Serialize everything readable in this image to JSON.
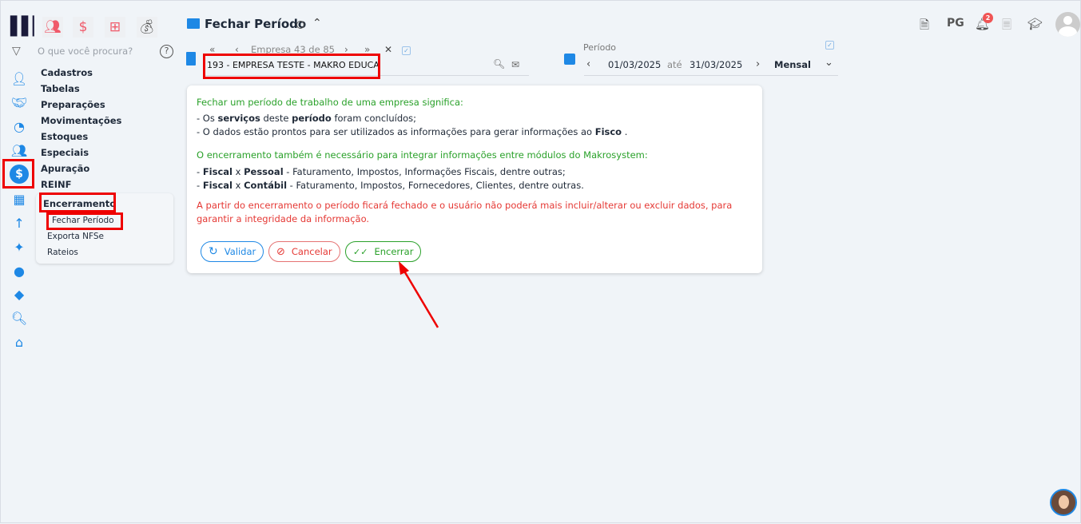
{
  "app": {
    "logo": "M"
  },
  "top_modules": [
    {
      "icon": "people-icon"
    },
    {
      "icon": "dollar-icon",
      "glyph": "$"
    },
    {
      "icon": "calculator-icon"
    },
    {
      "icon": "money-bag-icon"
    }
  ],
  "search": {
    "placeholder": "O que você procura?"
  },
  "menu": {
    "items": [
      "Cadastros",
      "Tabelas",
      "Preparações",
      "Movimentações",
      "Estoques",
      "Especiais",
      "Apuração",
      "REINF"
    ],
    "group": "Encerramento",
    "subitems": [
      "Fechar Período",
      "Exporta NFSe",
      "Rateios"
    ]
  },
  "header": {
    "title": "Fechar Período",
    "pg": "PG",
    "notifications": "2"
  },
  "company": {
    "nav": "Empresa 43 de 85",
    "value": "193 - EMPRESA TESTE - MAKRO EDUCA"
  },
  "period": {
    "label": "Período",
    "from": "01/03/2025",
    "until": "até",
    "to": "31/03/2025",
    "type": "Mensal"
  },
  "card": {
    "heading1": "Fechar um período de trabalho de uma empresa significa:",
    "l1": {
      "a": "- Os ",
      "b": "serviços",
      "c": " deste ",
      "d": "período",
      "e": " foram concluídos;"
    },
    "l2": {
      "a": "- O dados estão prontos para ser utilizados as informações para gerar informações ao ",
      "b": "Fisco",
      "c": " ."
    },
    "heading2": "O encerramento também é necessário para integrar informações entre módulos do Makrosystem:",
    "l3": {
      "a": "- ",
      "b": "Fiscal",
      "c": " x ",
      "d": "Pessoal",
      "e": " - Faturamento, Impostos, Informações Fiscais, dentre outras;"
    },
    "l4": {
      "a": "- ",
      "b": "Fiscal",
      "c": " x ",
      "d": "Contábil",
      "e": " - Faturamento, Impostos, Fornecedores, Clientes, dentre outras."
    },
    "warning1": "A partir do encerramento o período ficará fechado e o usuário não poderá mais incluir/alterar ou excluir dados, para",
    "warning2": "garantir a integridade da informação.",
    "buttons": {
      "validar": "Validar",
      "cancelar": "Cancelar",
      "encerrar": "Encerrar"
    }
  },
  "colors": {
    "accent": "#1e88e5",
    "green": "#2aa12a",
    "red": "#e53935",
    "highlight": "#e00000"
  }
}
